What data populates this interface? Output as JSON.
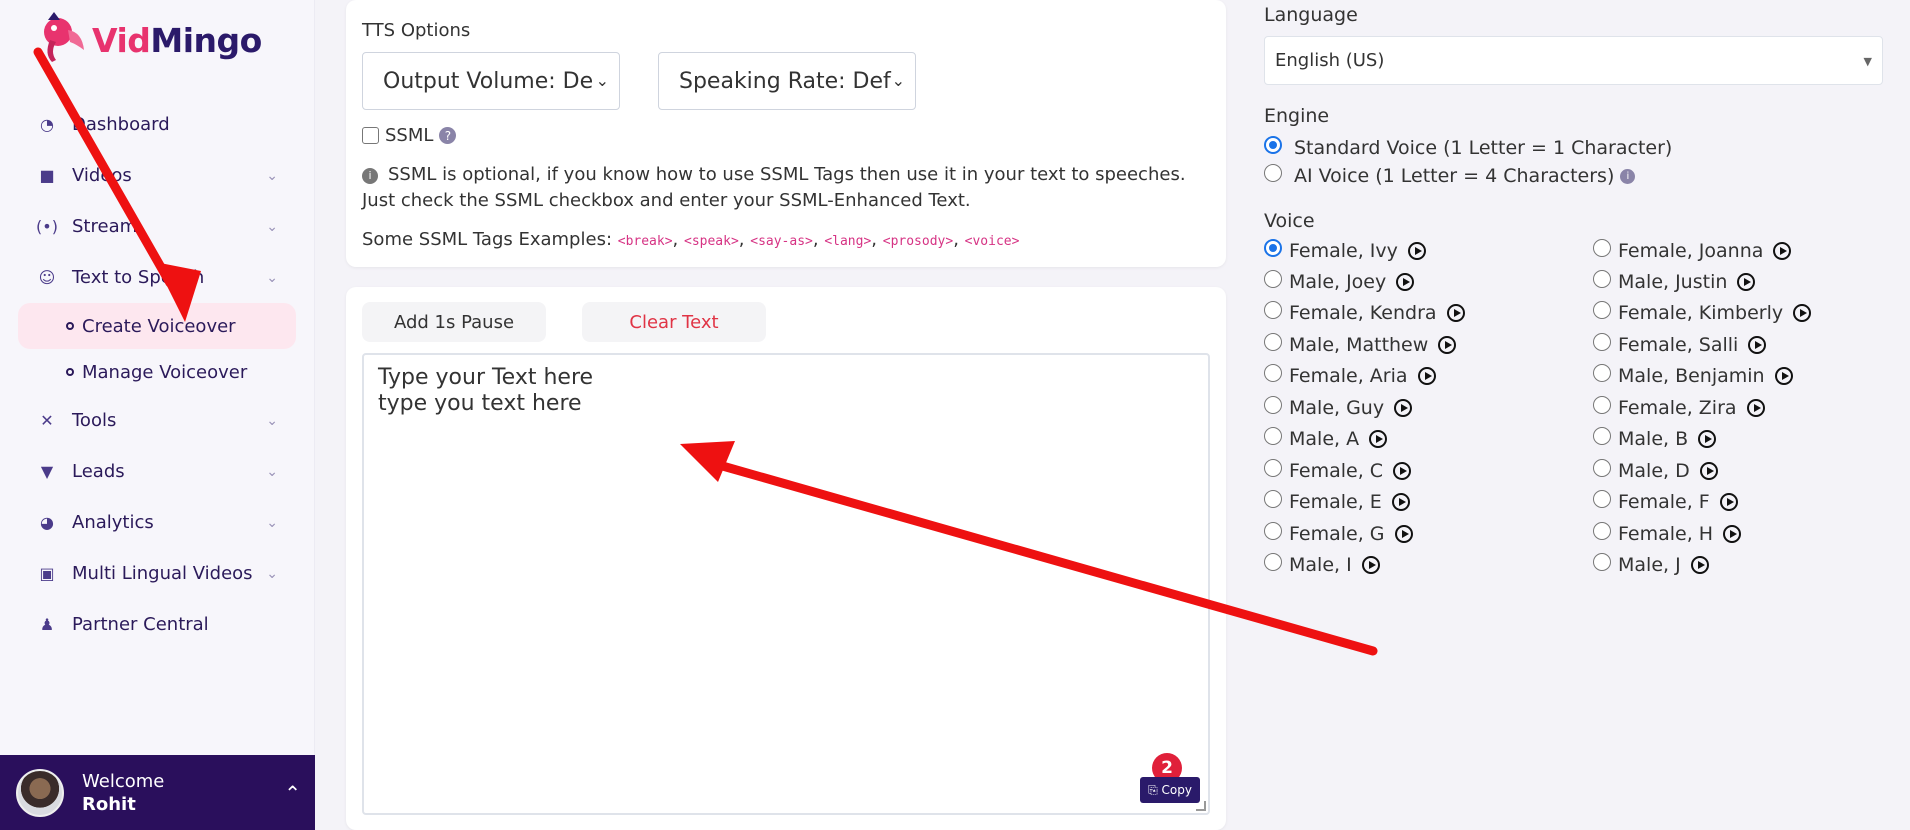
{
  "brand": {
    "part1": "Vid",
    "part2": "Mingo"
  },
  "sidebar": {
    "items": [
      {
        "label": "Dashboard",
        "icon": "dashboard-icon"
      },
      {
        "label": "Videos",
        "icon": "video-icon"
      },
      {
        "label": "Stream",
        "icon": "stream-icon"
      },
      {
        "label": "Text to Speech",
        "icon": "speech-icon"
      },
      {
        "label": "Tools",
        "icon": "tools-icon"
      },
      {
        "label": "Leads",
        "icon": "filter-icon"
      },
      {
        "label": "Analytics",
        "icon": "pie-chart-icon"
      },
      {
        "label": "Multi Lingual Videos",
        "icon": "translate-icon"
      },
      {
        "label": "Partner Central",
        "icon": "people-icon"
      }
    ],
    "sub_items": [
      {
        "label": "Create Voiceover"
      },
      {
        "label": "Manage Voiceover"
      }
    ]
  },
  "user": {
    "welcome": "Welcome",
    "name": "Rohit"
  },
  "tts": {
    "title": "TTS Options",
    "volume_select": "Output Volume: De",
    "rate_select": "Speaking Rate: Def",
    "ssml_label": "SSML",
    "info_text": "SSML is optional, if you know how to use SSML Tags then use it in your text to speeches. Just check the SSML checkbox and enter your SSML-Enhanced Text.",
    "examples_label": "Some SSML Tags Examples:",
    "examples": [
      "<break>",
      "<speak>",
      "<say-as>",
      "<lang>",
      "<prosody>",
      "<voice>"
    ]
  },
  "editor": {
    "pause_button": "Add 1s Pause",
    "clear_button": "Clear Text",
    "line1": "Type your Text here",
    "line2": "type you text here",
    "copy_label": "Copy",
    "badge": "2"
  },
  "right": {
    "language_label": "Language",
    "language_value": "English (US)",
    "engine_label": "Engine",
    "engine_options": [
      {
        "label": "Standard Voice (1 Letter = 1 Character)",
        "selected": true
      },
      {
        "label": "AI Voice (1 Letter = 4 Characters)",
        "selected": false
      }
    ],
    "voice_label": "Voice",
    "voices_left": [
      "Female, Ivy",
      "Male, Joey",
      "Female, Kendra",
      "Male, Matthew",
      "Female, Aria",
      "Male, Guy",
      "Male, A",
      "Female, C",
      "Female, E",
      "Female, G",
      "Male, I"
    ],
    "voices_right": [
      "Female, Joanna",
      "Male, Justin",
      "Female, Kimberly",
      "Female, Salli",
      "Male, Benjamin",
      "Female, Zira",
      "Male, B",
      "Male, D",
      "Female, F",
      "Female, H",
      "Male, J"
    ],
    "selected_voice": "Female, Ivy"
  },
  "colors": {
    "accent": "#e8336e",
    "brand_dark": "#2a0f5c",
    "annotation_arrow": "#ee1111"
  }
}
